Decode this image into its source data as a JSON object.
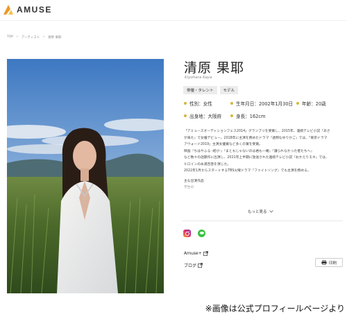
{
  "header": {
    "logo_text": "AMUSE",
    "logo_color": "#e99a2a"
  },
  "breadcrumb": [
    "TOP",
    ">",
    "アーティスト",
    ">",
    "清原 果耶"
  ],
  "profile": {
    "name": "清原 果耶",
    "name_roman": "Kiyohara Kaya",
    "tags": [
      "俳優・タレント",
      "モデル"
    ],
    "rows": [
      [
        "性別：女性",
        "生年月日：2002年1月30日",
        "年齢：20歳"
      ],
      [
        "出身地：大阪府",
        "身長：162cm"
      ]
    ],
    "accent_color": "#d4b73b",
    "bio": [
      "「アミューズオーディションフェス2014」グランプリを受賞し、2015年、連続テレビ小説『あさ",
      "が来た』で女優デビュー。2018年に主演を務めたドラマ『透明なゆりかご』では、「東京ドラマ",
      "アウォード2019」主演女優賞など多くの賞を受賞。",
      "映画『ちはやふる -結び-』『まともじゃないのは君も一緒』『護られなかった者たちへ』",
      "など数々の話題作に出演し、2021年上半期に放送された連続テレビ小説『おかえりモネ』では、",
      "ヒロインの永浦百音を演じた。",
      "2022年1月からスタートするTBS火曜ドラマ『ファイトソング』でも主演を務める。"
    ],
    "works_heading": "主な出演作品",
    "works_more": "学生の",
    "more_label": "もっと見る",
    "links": [
      "Amuse+",
      "ブログ"
    ],
    "print_label": "印刷"
  },
  "caption": "※画像は公式プロフィールページより"
}
